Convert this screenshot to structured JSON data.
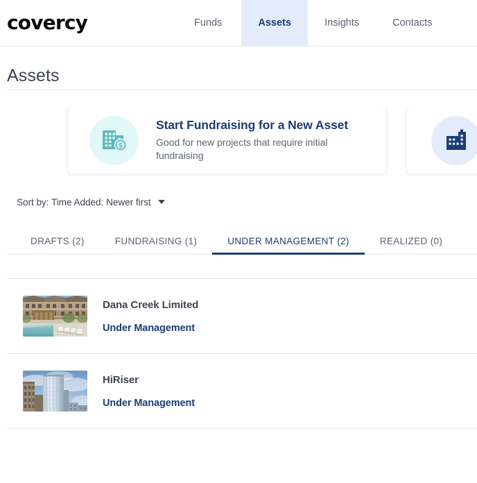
{
  "header": {
    "logo_text": "covercy",
    "nav": [
      {
        "label": "Funds",
        "active": false
      },
      {
        "label": "Assets",
        "active": true
      },
      {
        "label": "Insights",
        "active": false
      },
      {
        "label": "Contacts",
        "active": false
      }
    ]
  },
  "page": {
    "title": "Assets"
  },
  "cards": [
    {
      "title": "Start Fundraising for a New Asset",
      "subtitle": "Good for new projects that require initial fundraising",
      "icon": "building-dollar-icon",
      "icon_bg": "#e2f7f8",
      "icon_color": "#5cb8bd"
    },
    {
      "title": "",
      "subtitle": "",
      "icon": "building-icon",
      "icon_bg": "#e4ebfa",
      "icon_color": "#1b3d75"
    }
  ],
  "sort": {
    "label": "Sort by: Time Added: Newer first",
    "icon": "chevron-down-icon"
  },
  "tabs": [
    {
      "label": "DRAFTS (2)",
      "active": false
    },
    {
      "label": "FUNDRAISING (1)",
      "active": false
    },
    {
      "label": "UNDER MANAGEMENT (2)",
      "active": true
    },
    {
      "label": "REALIZED (0)",
      "active": false
    }
  ],
  "assets": [
    {
      "name": "Dana Creek Limited",
      "status": "Under Management",
      "thumbnail": "apartment-complex-pool-photo"
    },
    {
      "name": "HiRiser",
      "status": "Under Management",
      "thumbnail": "glass-skyscraper-photo"
    }
  ],
  "colors": {
    "navy": "#1b3d75",
    "active_tab_bg": "#e4ebfa",
    "text_muted": "#5c6370",
    "divider": "#e7e9ee"
  }
}
